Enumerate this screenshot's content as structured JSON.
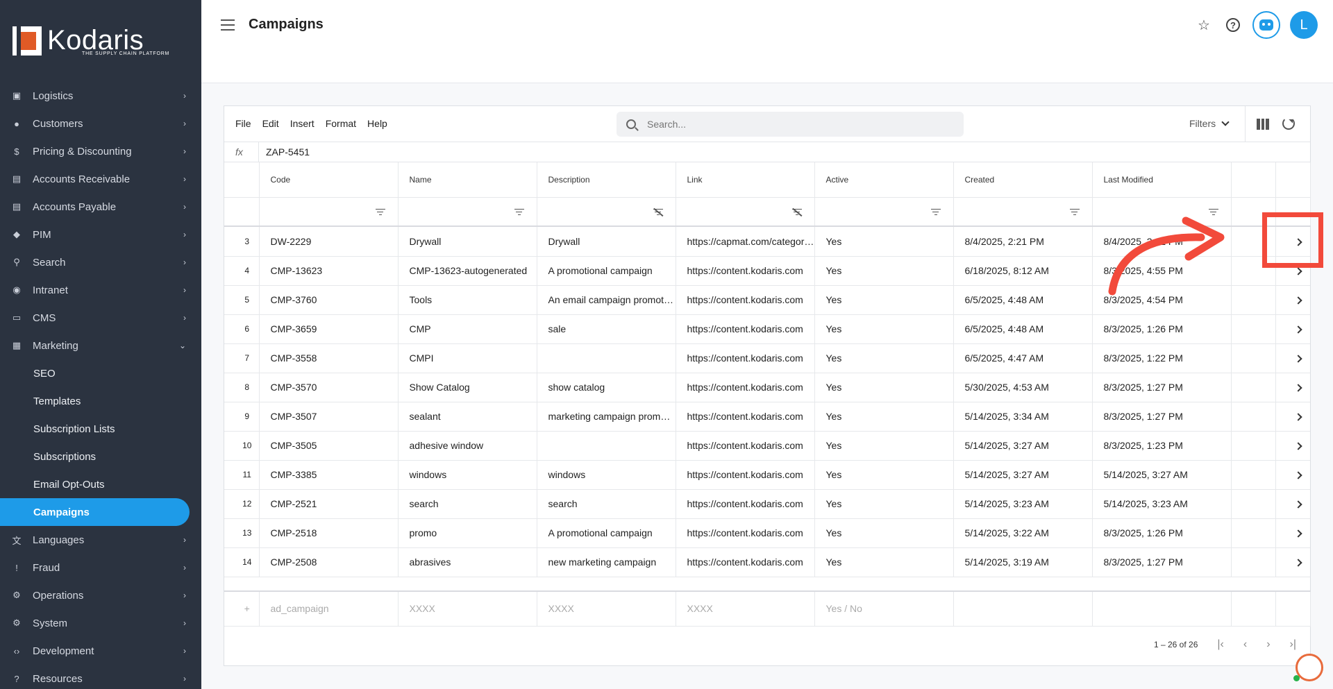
{
  "brand": {
    "name": "Kodaris",
    "tagline": "THE SUPPLY CHAIN PLATFORM"
  },
  "sidebar": {
    "items": [
      {
        "label": "Logistics",
        "icon": "truck-icon",
        "glyph": "▣"
      },
      {
        "label": "Customers",
        "icon": "people-icon",
        "glyph": "●"
      },
      {
        "label": "Pricing & Discounting",
        "icon": "dollar-icon",
        "glyph": "$"
      },
      {
        "label": "Accounts Receivable",
        "icon": "bank-icon",
        "glyph": "▤"
      },
      {
        "label": "Accounts Payable",
        "icon": "bank-icon",
        "glyph": "▤"
      },
      {
        "label": "PIM",
        "icon": "tag-icon",
        "glyph": "◆"
      },
      {
        "label": "Search",
        "icon": "search-icon",
        "glyph": "⚲"
      },
      {
        "label": "Intranet",
        "icon": "globe-icon",
        "glyph": "◉"
      },
      {
        "label": "CMS",
        "icon": "browser-icon",
        "glyph": "▭"
      },
      {
        "label": "Marketing",
        "icon": "megaphone-icon",
        "glyph": "▦"
      }
    ],
    "marketing_sub": [
      "SEO",
      "Templates",
      "Subscription Lists",
      "Subscriptions",
      "Email Opt-Outs",
      "Campaigns"
    ],
    "active_sub": "Campaigns",
    "items_after": [
      {
        "label": "Languages",
        "icon": "translate-icon",
        "glyph": "文"
      },
      {
        "label": "Fraud",
        "icon": "alert-icon",
        "glyph": "!"
      },
      {
        "label": "Operations",
        "icon": "gears-icon",
        "glyph": "⚙"
      },
      {
        "label": "System",
        "icon": "gear-icon",
        "glyph": "⚙"
      },
      {
        "label": "Development",
        "icon": "code-icon",
        "glyph": "‹›"
      },
      {
        "label": "Resources",
        "icon": "help-circle-icon",
        "glyph": "?"
      }
    ]
  },
  "header": {
    "title": "Campaigns",
    "avatar_initial": "L"
  },
  "toolbar": {
    "menu": [
      "File",
      "Edit",
      "Insert",
      "Format",
      "Help"
    ],
    "search_placeholder": "Search...",
    "filters_label": "Filters"
  },
  "formula_bar": {
    "label": "fx",
    "value": "ZAP-5451"
  },
  "grid": {
    "columns": [
      "Code",
      "Name",
      "Description",
      "Link",
      "Active",
      "Created",
      "Last Modified"
    ],
    "filter_disabled": [
      false,
      false,
      true,
      true,
      false,
      false,
      false
    ],
    "rows": [
      [
        "3",
        "DW-2229",
        "Drywall",
        "Drywall",
        "https://capmat.com/category/drywall",
        "Yes",
        "8/4/2025, 2:21 PM",
        "8/4/2025, 2:21 PM"
      ],
      [
        "4",
        "CMP-13623",
        "CMP-13623-autogenerated",
        "A promotional campaign",
        "https://content.kodaris.com",
        "Yes",
        "6/18/2025, 8:12 AM",
        "8/3/2025, 4:55 PM"
      ],
      [
        "5",
        "CMP-3760",
        "Tools",
        "An email campaign promoting tools",
        "https://content.kodaris.com",
        "Yes",
        "6/5/2025, 4:48 AM",
        "8/3/2025, 4:54 PM"
      ],
      [
        "6",
        "CMP-3659",
        "CMP",
        "sale",
        "https://content.kodaris.com",
        "Yes",
        "6/5/2025, 4:48 AM",
        "8/3/2025, 1:26 PM"
      ],
      [
        "7",
        "CMP-3558",
        "CMPI",
        "",
        "https://content.kodaris.com",
        "Yes",
        "6/5/2025, 4:47 AM",
        "8/3/2025, 1:22 PM"
      ],
      [
        "8",
        "CMP-3570",
        "Show Catalog",
        "show catalog",
        "https://content.kodaris.com",
        "Yes",
        "5/30/2025, 4:53 AM",
        "8/3/2025, 1:27 PM"
      ],
      [
        "9",
        "CMP-3507",
        "sealant",
        "marketing campaign promoting sealant",
        "https://content.kodaris.com",
        "Yes",
        "5/14/2025, 3:34 AM",
        "8/3/2025, 1:27 PM"
      ],
      [
        "10",
        "CMP-3505",
        "adhesive window",
        "",
        "https://content.kodaris.com",
        "Yes",
        "5/14/2025, 3:27 AM",
        "8/3/2025, 1:23 PM"
      ],
      [
        "11",
        "CMP-3385",
        "windows",
        "windows",
        "https://content.kodaris.com",
        "Yes",
        "5/14/2025, 3:27 AM",
        "5/14/2025, 3:27 AM"
      ],
      [
        "12",
        "CMP-2521",
        "search",
        "search",
        "https://content.kodaris.com",
        "Yes",
        "5/14/2025, 3:23 AM",
        "5/14/2025, 3:23 AM"
      ],
      [
        "13",
        "CMP-2518",
        "promo",
        "A promotional campaign",
        "https://content.kodaris.com",
        "Yes",
        "5/14/2025, 3:22 AM",
        "8/3/2025, 1:26 PM"
      ],
      [
        "14",
        "CMP-2508",
        "abrasives",
        "new marketing campaign",
        "https://content.kodaris.com",
        "Yes",
        "5/14/2025, 3:19 AM",
        "8/3/2025, 1:27 PM"
      ]
    ],
    "new_row": [
      "ad_campaign",
      "XXXX",
      "XXXX",
      "XXXX",
      "Yes / No"
    ]
  },
  "pager": {
    "range": "1 – 26 of 26"
  },
  "colors": {
    "accent": "#1e9be8",
    "sidebar": "#2b3340",
    "annotation": "#f24a3b"
  }
}
